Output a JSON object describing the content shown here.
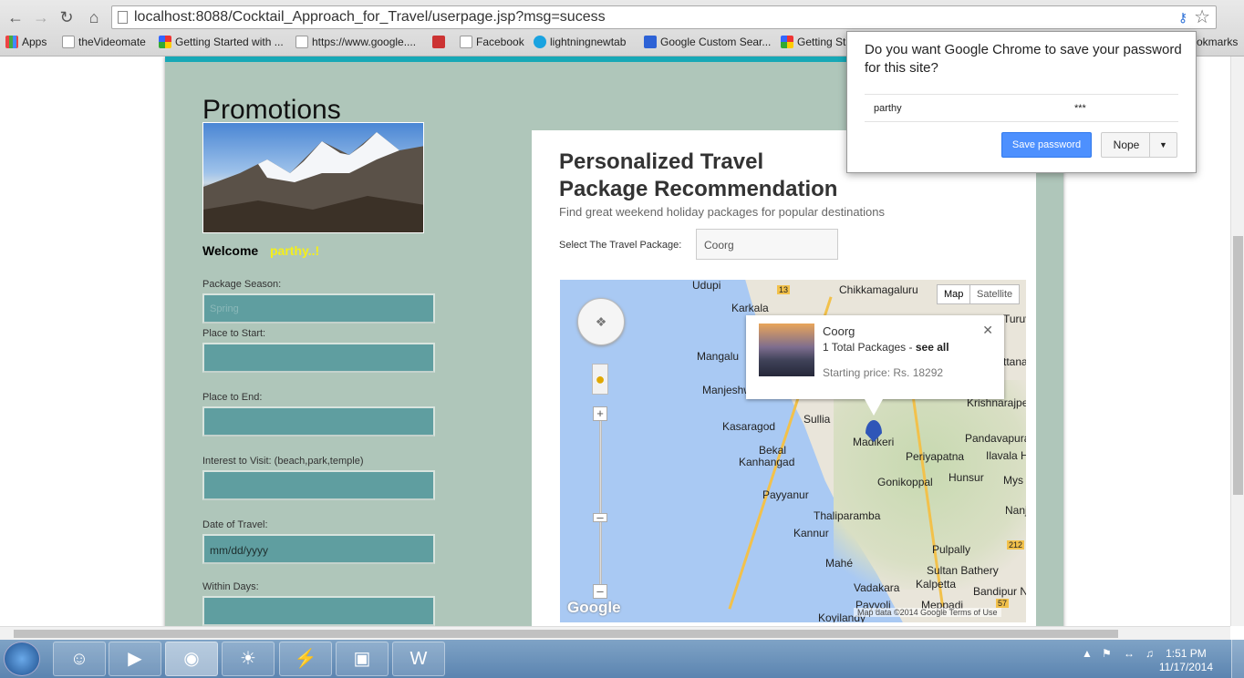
{
  "browser": {
    "url_host": "localhost:8088/Cocktail_Approach_for_Travel/userpage.jsp?msg=sucess",
    "bookmarks": [
      "Apps",
      "theVideomate",
      "Getting Started with ...",
      "https://www.google....",
      "Facebook",
      "lightningnewtab",
      "Google Custom Sear...",
      "Getting Sta",
      "okmarks"
    ]
  },
  "left_panel": {
    "promotions_title": "Promotions",
    "welcome_label": "Welcome",
    "username": "parthy..!",
    "fields": {
      "package_season_label": "Package Season:",
      "package_season_placeholder": "Spring",
      "place_start_label": "Place to Start:",
      "place_end_label": "Place to End:",
      "interest_label": "Interest to Visit: (beach,park,temple)",
      "date_label": "Date of Travel:",
      "date_placeholder": "mm/dd/yyyy",
      "within_days_label": "Within Days:"
    }
  },
  "main": {
    "title": "Personalized Travel Package Recommendation",
    "subtitle": "Find great weekend holiday packages for popular destinations",
    "select_label": "Select The Travel Package:",
    "select_value": "Coorg"
  },
  "map": {
    "type_map": "Map",
    "type_satellite": "Satellite",
    "labels": [
      "Udupi",
      "Karkala",
      "Chikkamagaluru",
      "Mangalu",
      "Manjeshw",
      "Kasaragod",
      "Sullia",
      "Bekal",
      "Kanhangad",
      "Madikeri",
      "Periyapatna",
      "Gonikoppal",
      "Hunsur",
      "Mys",
      "Payyanur",
      "Thaliparamba",
      "Kannur",
      "Pulpally",
      "Mahé",
      "Sultan Bathery",
      "Vadakara",
      "Kalpetta",
      "Bandipur Na",
      "Payyoli",
      "Meppadi",
      "Koyilandy",
      "Krishnarajpet",
      "Pandavapura",
      "Ilavala H",
      "Turuv",
      "ttana",
      "Nanj"
    ],
    "road_numbers": [
      "13",
      "212",
      "57"
    ],
    "info": {
      "name": "Coorg",
      "packages": "1 Total Packages - ",
      "see_all": "see all",
      "price": "Starting price: Rs. 18292"
    },
    "footer": "Map data ©2014 Google    Terms of Use",
    "google": "Google"
  },
  "password_popup": {
    "question": "Do you want Google Chrome to save your password for this site?",
    "username": "parthy",
    "password": "***",
    "save_label": "Save password",
    "nope_label": "Nope"
  },
  "taskbar": {
    "time": "1:51 PM",
    "date": "11/17/2014"
  }
}
